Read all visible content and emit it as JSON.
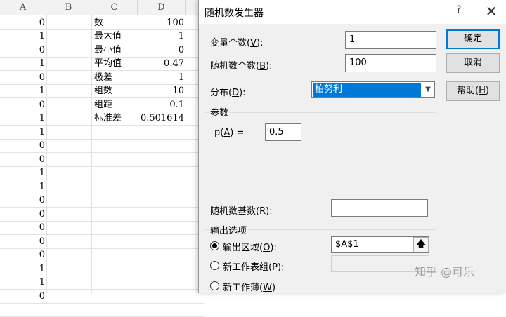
{
  "sheet": {
    "columns": [
      "A",
      "B",
      "C",
      "D"
    ],
    "column_a": [
      "0",
      "1",
      "0",
      "1",
      "0",
      "1",
      "0",
      "1",
      "1",
      "0",
      "0",
      "1",
      "1",
      "0",
      "0",
      "0",
      "0",
      "0",
      "1",
      "1",
      "0"
    ],
    "stats": [
      {
        "label": "数",
        "value": "100"
      },
      {
        "label": "最大值",
        "value": "1"
      },
      {
        "label": "最小值",
        "value": "0"
      },
      {
        "label": "平均值",
        "value": "0.47"
      },
      {
        "label": "极差",
        "value": "1"
      },
      {
        "label": "组数",
        "value": "10"
      },
      {
        "label": "组距",
        "value": "0.1"
      },
      {
        "label": "标准差",
        "value": "0.501614"
      }
    ]
  },
  "dialog": {
    "title": "随机数发生器",
    "help_glyph": "?",
    "close_glyph": "✕",
    "variables_label": "变量个数",
    "variables_key": "V",
    "variables_value": "1",
    "count_label": "随机数个数",
    "count_key": "B",
    "count_value": "100",
    "distribution_label": "分布",
    "distribution_key": "D",
    "distribution_value": "柏努利",
    "params_group": "参数",
    "p_label": "p(",
    "p_key": "A",
    "p_suffix": ") =",
    "p_value": "0.5",
    "seed_label": "随机数基数",
    "seed_key": "R",
    "seed_value": "",
    "output_group": "输出选项",
    "output_range_label": "输出区域",
    "output_range_key": "O",
    "output_range_value": "$A$1",
    "new_sheet_label": "新工作表组",
    "new_sheet_key": "P",
    "new_workbook_label": "新工作薄",
    "new_workbook_key": "W",
    "ok_label": "确定",
    "cancel_label": "取消",
    "help_label": "帮助",
    "help_key": "H"
  },
  "watermark": "知乎 @可乐",
  "colors": {
    "accent": "#0078d7",
    "dialog_bg": "#f0f0f0"
  }
}
